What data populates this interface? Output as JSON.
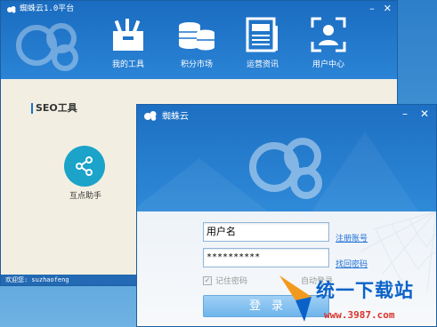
{
  "main_window": {
    "title": "蜘蛛云1.0平台",
    "controls": {
      "minimize": "–",
      "close": "✕"
    },
    "nav": [
      {
        "label": "我的工具"
      },
      {
        "label": "积分市场"
      },
      {
        "label": "运营资讯"
      },
      {
        "label": "用户中心"
      }
    ],
    "section_title": "SEO工具",
    "tool": {
      "label": "互点助手"
    },
    "status": "欢迎您: suzhaofeng"
  },
  "login_window": {
    "title": "蜘蛛云",
    "controls": {
      "minimize": "–",
      "close": "✕"
    },
    "username_value": "用户名",
    "password_value": "**********",
    "register_link": "注册账号",
    "recover_link": "找回密码",
    "remember_label": "记住密码",
    "auto_login_label": "自动登录",
    "login_button": "登录"
  },
  "watermark": {
    "text": "统一下载站",
    "url": "www.3987.com"
  },
  "colors": {
    "header_blue": "#1a6cc0",
    "link_blue": "#1d6fd6",
    "button_blue": "#6fb4ec",
    "share_teal": "#1ba3c9"
  }
}
